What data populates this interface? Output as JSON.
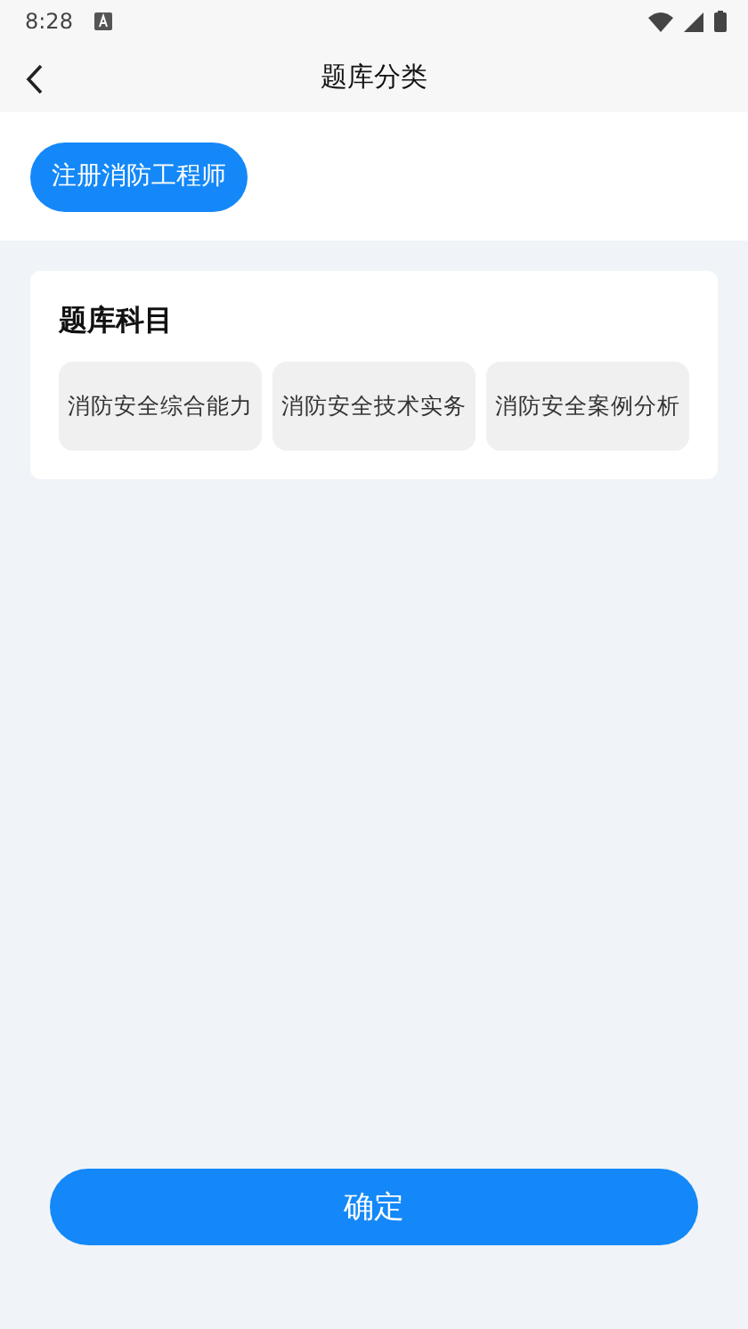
{
  "status_bar": {
    "time": "8:28"
  },
  "header": {
    "title": "题库分类"
  },
  "categories": [
    {
      "label": "注册消防工程师",
      "selected": true
    }
  ],
  "subjects_card": {
    "title": "题库科目",
    "subjects": [
      {
        "label": "消防安全综合能力",
        "selected": false
      },
      {
        "label": "消防安全技术实务",
        "selected": false
      },
      {
        "label": "消防安全案例分析",
        "selected": false
      }
    ]
  },
  "confirm_button": "确定"
}
